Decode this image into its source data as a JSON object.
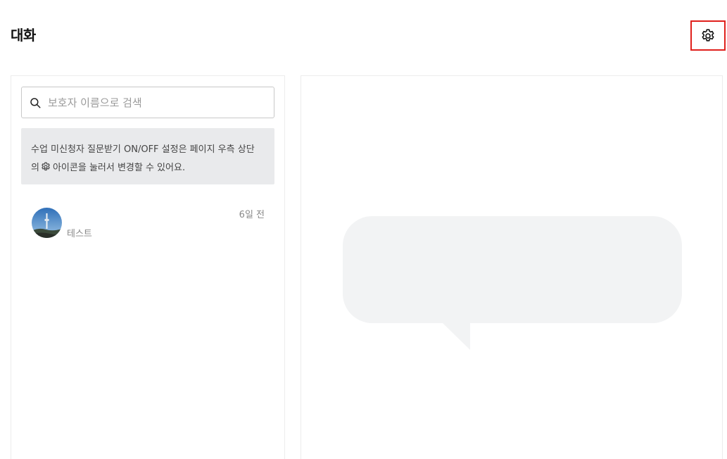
{
  "header": {
    "title": "대화",
    "settings_icon": "gear-icon"
  },
  "search": {
    "placeholder": "보호자 이름으로 검색",
    "value": "",
    "icon": "search-icon"
  },
  "notice": {
    "text_before_icon": "수업 미신청자 질문받기 ON/OFF 설정은 페이지 우측 상단 의",
    "icon": "gear-icon",
    "text_after_icon": "아이콘을 눌러서 변경할 수 있어요."
  },
  "conversations": [
    {
      "preview": "테스트",
      "time": "6일 전",
      "avatar": "tower-photo-avatar"
    }
  ],
  "empty_state": {
    "icon": "speech-bubble-icon"
  },
  "colors": {
    "highlight_border": "#e0201c",
    "notice_background": "#e9eaec",
    "bubble_fill": "#f2f3f4"
  }
}
